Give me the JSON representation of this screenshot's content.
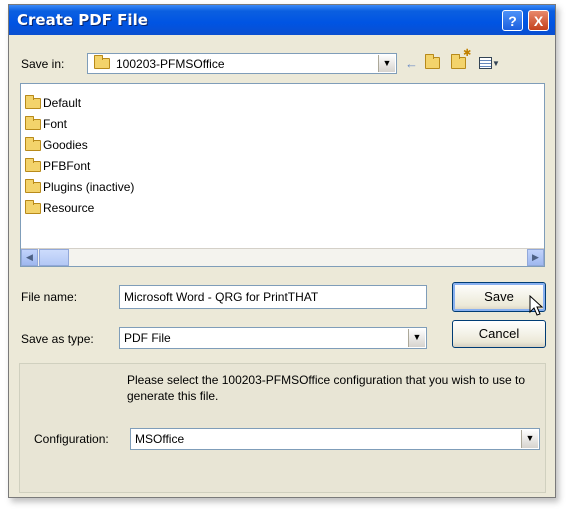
{
  "window": {
    "title": "Create PDF File",
    "help_label": "?",
    "close_label": "X"
  },
  "save_in": {
    "label": "Save in:",
    "value": "100203-PFMSOffice"
  },
  "toolbar": {
    "back_icon": "back-arrow-icon",
    "up_icon": "up-folder-icon",
    "new_folder_icon": "new-folder-icon",
    "view_icon": "view-menu-icon"
  },
  "files": [
    {
      "name": "Default"
    },
    {
      "name": "Font"
    },
    {
      "name": "Goodies"
    },
    {
      "name": "PFBFont"
    },
    {
      "name": "Plugins (inactive)"
    },
    {
      "name": "Resource"
    }
  ],
  "file_name": {
    "label": "File name:",
    "value": "Microsoft Word - QRG for PrintTHAT"
  },
  "save_as_type": {
    "label": "Save as type:",
    "value": "PDF File"
  },
  "buttons": {
    "save": "Save",
    "cancel": "Cancel"
  },
  "configuration": {
    "message": "Please select the 100203-PFMSOffice configuration that you wish to use to generate this file.",
    "label": "Configuration:",
    "value": "MSOffice"
  },
  "colors": {
    "titlebar": "#0054e3",
    "dialog_bg": "#ece9d8"
  }
}
